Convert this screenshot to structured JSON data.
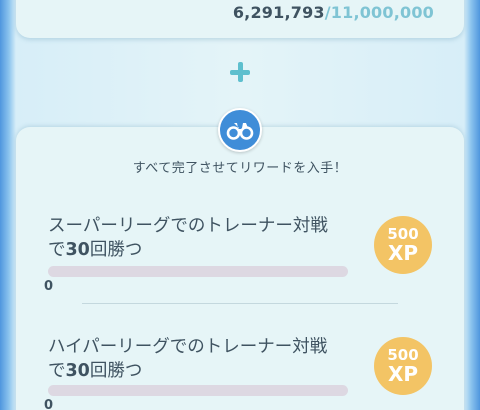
{
  "progress": {
    "current": "6,291,793",
    "separator": "/",
    "total": "11,000,000"
  },
  "reward_section": {
    "subtitle": "すべて完了させてリワードを入手！"
  },
  "tasks": [
    {
      "title_line1": "スーパーリーグでのトレーナー対戦",
      "title_pre": "で",
      "title_bold": "30",
      "title_post": "回勝つ",
      "progress_value": "0",
      "progress_fraction": 0,
      "reward_amount": "500",
      "reward_unit": "XP"
    },
    {
      "title_line1": "ハイパーリーグでのトレーナー対戦",
      "title_pre": "で",
      "title_bold": "30",
      "title_post": "回勝つ",
      "progress_value": "0",
      "progress_fraction": 0,
      "reward_amount": "500",
      "reward_unit": "XP"
    }
  ],
  "icons": {
    "plus": "plus-icon",
    "badge": "binoculars-icon"
  },
  "colors": {
    "accent_teal": "#5ebfce",
    "badge_blue": "#3f8dd8",
    "xp_gold": "#f3c465",
    "card_bg": "#e6f5f7",
    "text": "#3f5361"
  }
}
